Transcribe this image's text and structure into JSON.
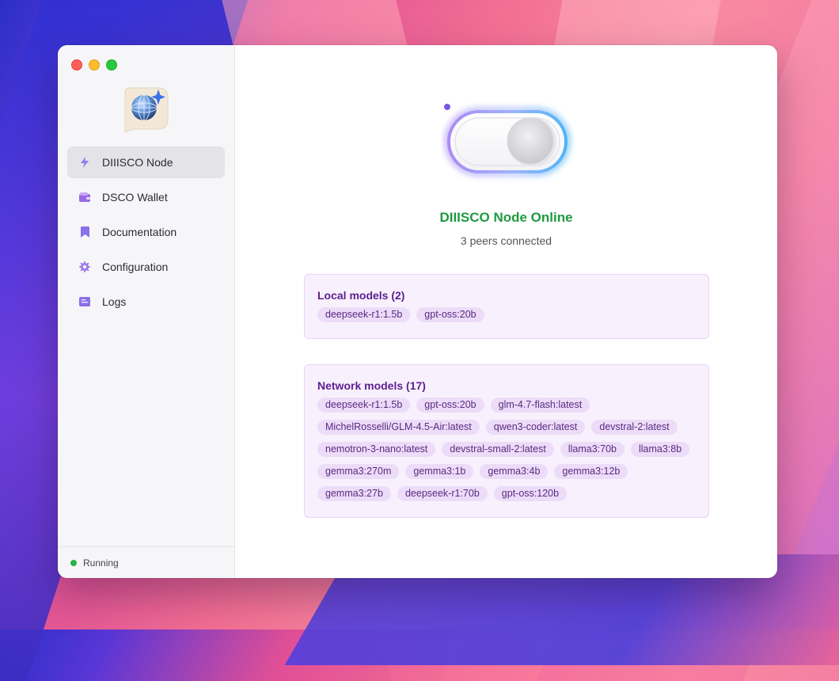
{
  "sidebar": {
    "items": [
      {
        "label": "DIIISCO Node",
        "icon": "lightning-icon",
        "active": true
      },
      {
        "label": "DSCO Wallet",
        "icon": "wallet-icon",
        "active": false
      },
      {
        "label": "Documentation",
        "icon": "bookmark-icon",
        "active": false
      },
      {
        "label": "Configuration",
        "icon": "gear-icon",
        "active": false
      },
      {
        "label": "Logs",
        "icon": "logs-icon",
        "active": false
      }
    ],
    "status": "Running"
  },
  "node": {
    "title": "DIIISCO Node Online",
    "peers": "3 peers connected",
    "toggle_on": true
  },
  "local_models": {
    "title": "Local models (2)",
    "items": [
      "deepseek-r1:1.5b",
      "gpt-oss:20b"
    ]
  },
  "network_models": {
    "title": "Network models (17)",
    "items": [
      "deepseek-r1:1.5b",
      "gpt-oss:20b",
      "glm-4.7-flash:latest",
      "MichelRosselli/GLM-4.5-Air:latest",
      "qwen3-coder:latest",
      "devstral-2:latest",
      "nemotron-3-nano:latest",
      "devstral-small-2:latest",
      "llama3:70b",
      "llama3:8b",
      "gemma3:270m",
      "gemma3:1b",
      "gemma3:4b",
      "gemma3:12b",
      "gemma3:27b",
      "deepseek-r1:70b",
      "gpt-oss:120b"
    ]
  },
  "colors": {
    "accent": "#5b1f8e",
    "online": "#1f9a3f",
    "chip_bg": "#ecdcf8",
    "card_bg": "#f8f1fd"
  }
}
